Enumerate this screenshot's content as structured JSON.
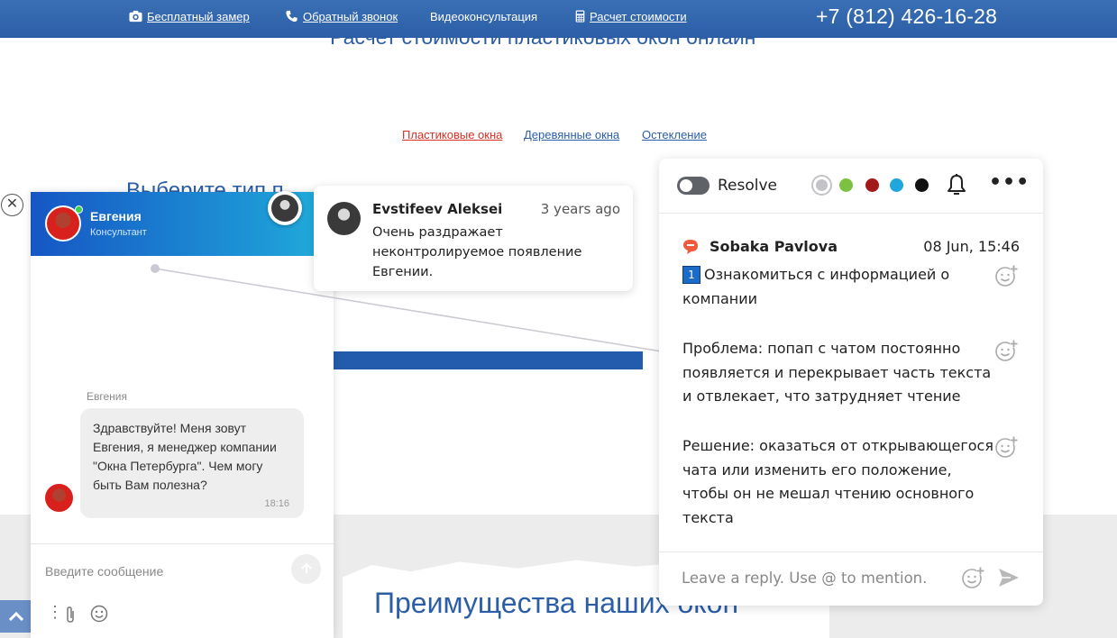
{
  "topbar": {
    "free_measure": "Бесплатный замер",
    "callback": "Обратный звонок",
    "video_consult": "Видеоконсультация",
    "cost_calc": "Расчет стоимости",
    "phone": "+7 (812) 426-16-28"
  },
  "page": {
    "heading": "Расчет стоимости пластиковых окон онлайн",
    "tabs": [
      "Пластиковые окна",
      "Деревянные окна",
      "Остекление"
    ],
    "choose_heading": "Выберите тип п",
    "advantages_heading": "Преимущества наших окон"
  },
  "chat": {
    "agent_name": "Евгения",
    "agent_role": "Консультант",
    "message_author": "Евгения",
    "message_text": "Здравствуйте! Меня зовут Евгения, я менеджер компании \"Окна Петербурга\". Чем могу быть Вам полезна?",
    "message_time": "18:16",
    "input_placeholder": "Введите сообщение"
  },
  "tooltip": {
    "author": "Evstifeev Aleksei",
    "time": "3 years ago",
    "text": "Очень раздражает неконтролируемое появление Евгении."
  },
  "panel": {
    "resolve_label": "Resolve",
    "colors": [
      "#c4c4c8",
      "#7cc242",
      "#a31818",
      "#1fa6dc",
      "#111111"
    ],
    "comment_author": "Sobaka Pavlova",
    "comment_date": "08 Jun, 15:46",
    "task_number": "1",
    "task_text": "Ознакомиться с информацией о компании",
    "problem_text": "Проблема: попап с чатом постоянно появляется и перекрывает часть текста и отвлекает, что затрудняет чтение",
    "solution_text": "Решение: оказаться от открывающегося чата или изменить его положение, чтобы он не мешал чтению основного текста",
    "reply_placeholder": "Leave a reply. Use @ to mention."
  }
}
